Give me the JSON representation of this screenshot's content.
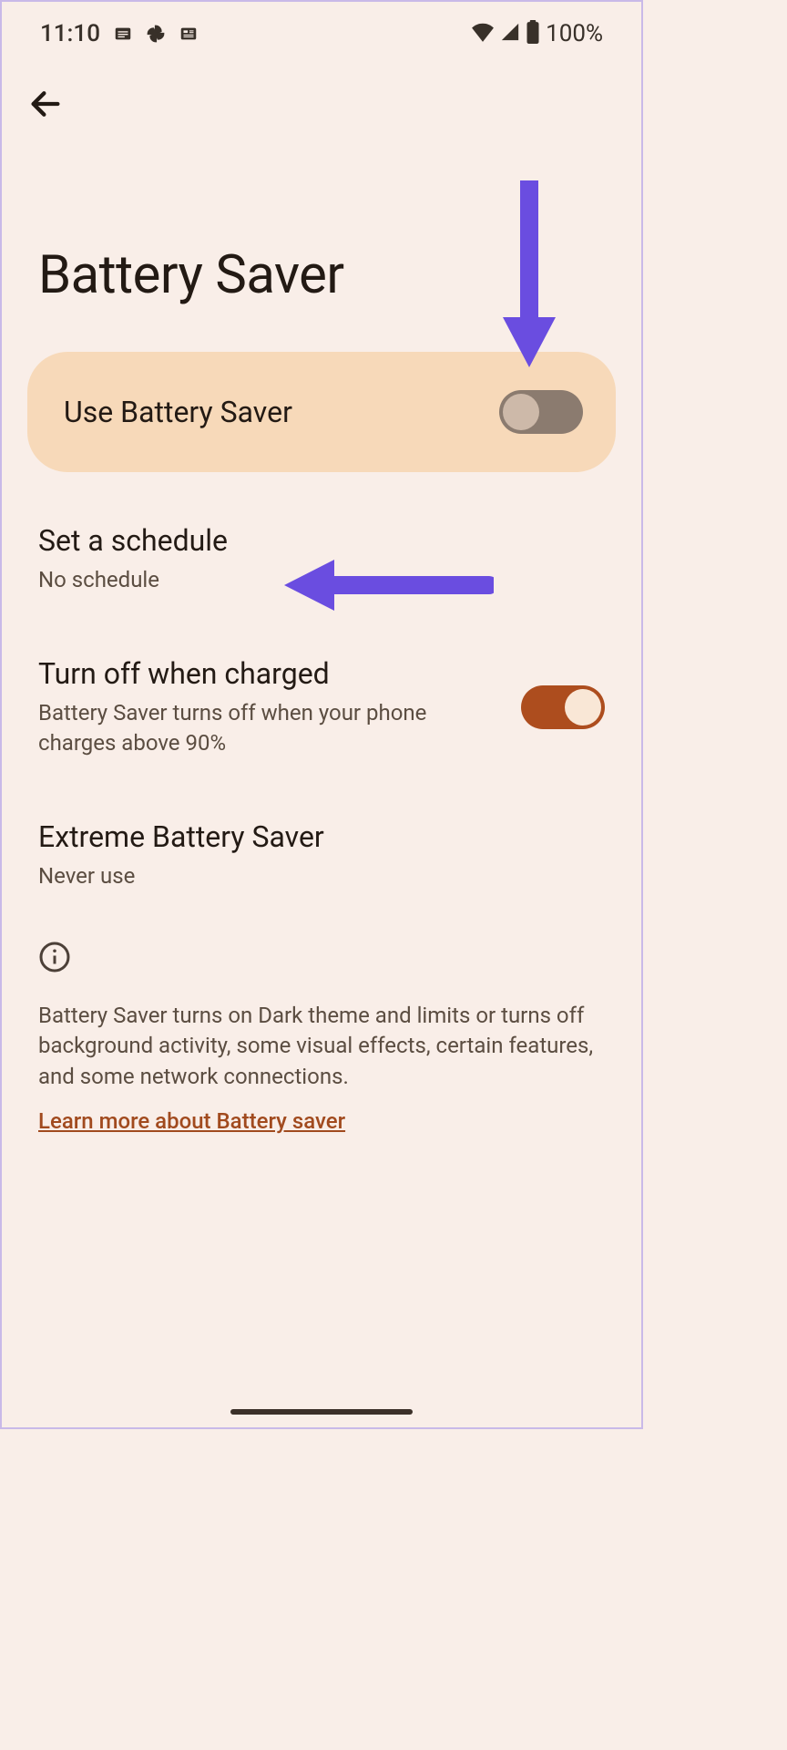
{
  "status": {
    "time": "11:10",
    "battery_percent": "100%"
  },
  "page": {
    "title": "Battery Saver"
  },
  "main_toggle": {
    "label": "Use Battery Saver",
    "state": "off"
  },
  "settings": {
    "schedule": {
      "title": "Set a schedule",
      "subtitle": "No schedule"
    },
    "turn_off": {
      "title": "Turn off when charged",
      "subtitle": "Battery Saver turns off when your phone charges above 90%",
      "state": "on"
    },
    "extreme": {
      "title": "Extreme Battery Saver",
      "subtitle": "Never use"
    }
  },
  "info": {
    "text": "Battery Saver turns on Dark theme and limits or turns off background activity, some visual effects, certain features, and some network connections.",
    "link": "Learn more about Battery saver"
  },
  "colors": {
    "background": "#f9eee8",
    "pill": "#f7d9b9",
    "accent": "#ad4d1e",
    "arrow": "#6a4de0"
  }
}
